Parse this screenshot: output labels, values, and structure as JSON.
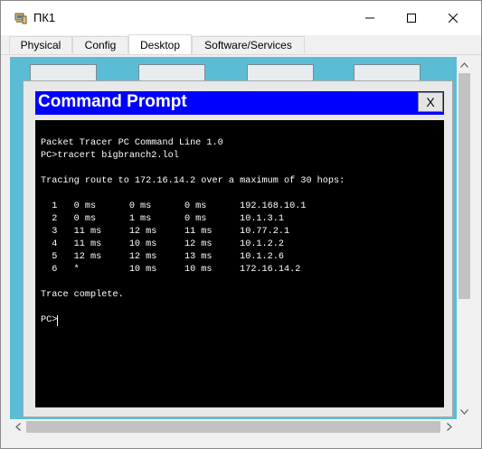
{
  "window": {
    "title": "ПК1",
    "icon": "pc-icon",
    "controls": [
      "minimize-icon",
      "maximize-icon",
      "close-icon"
    ]
  },
  "tabs": [
    {
      "label": "Physical",
      "active": false
    },
    {
      "label": "Config",
      "active": false
    },
    {
      "label": "Desktop",
      "active": true
    },
    {
      "label": "Software/Services",
      "active": false
    }
  ],
  "command_prompt": {
    "title": "Command Prompt",
    "close_label": "X",
    "title_color": "#0000ff",
    "terminal_background": "#000000",
    "terminal_foreground": "#ffffff",
    "header": "Packet Tracer PC Command Line 1.0",
    "prompt": "PC>",
    "command": "tracert bigbranch2.lol",
    "tracing_line": "Tracing route to 172.16.14.2 over a maximum of 30 hops:",
    "hops": [
      {
        "hop": "1",
        "t1": "0 ms",
        "t2": "0 ms",
        "t3": "0 ms",
        "address": "192.168.10.1"
      },
      {
        "hop": "2",
        "t1": "0 ms",
        "t2": "1 ms",
        "t3": "0 ms",
        "address": "10.1.3.1"
      },
      {
        "hop": "3",
        "t1": "11 ms",
        "t2": "12 ms",
        "t3": "11 ms",
        "address": "10.77.2.1"
      },
      {
        "hop": "4",
        "t1": "11 ms",
        "t2": "10 ms",
        "t3": "12 ms",
        "address": "10.1.2.2"
      },
      {
        "hop": "5",
        "t1": "12 ms",
        "t2": "12 ms",
        "t3": "13 ms",
        "address": "10.1.2.6"
      },
      {
        "hop": "6",
        "t1": "*",
        "t2": "10 ms",
        "t3": "10 ms",
        "address": "172.16.14.2"
      }
    ],
    "footer": "Trace complete.",
    "final_prompt": "PC>"
  },
  "desktop": {
    "background": "#5bbcd6"
  }
}
